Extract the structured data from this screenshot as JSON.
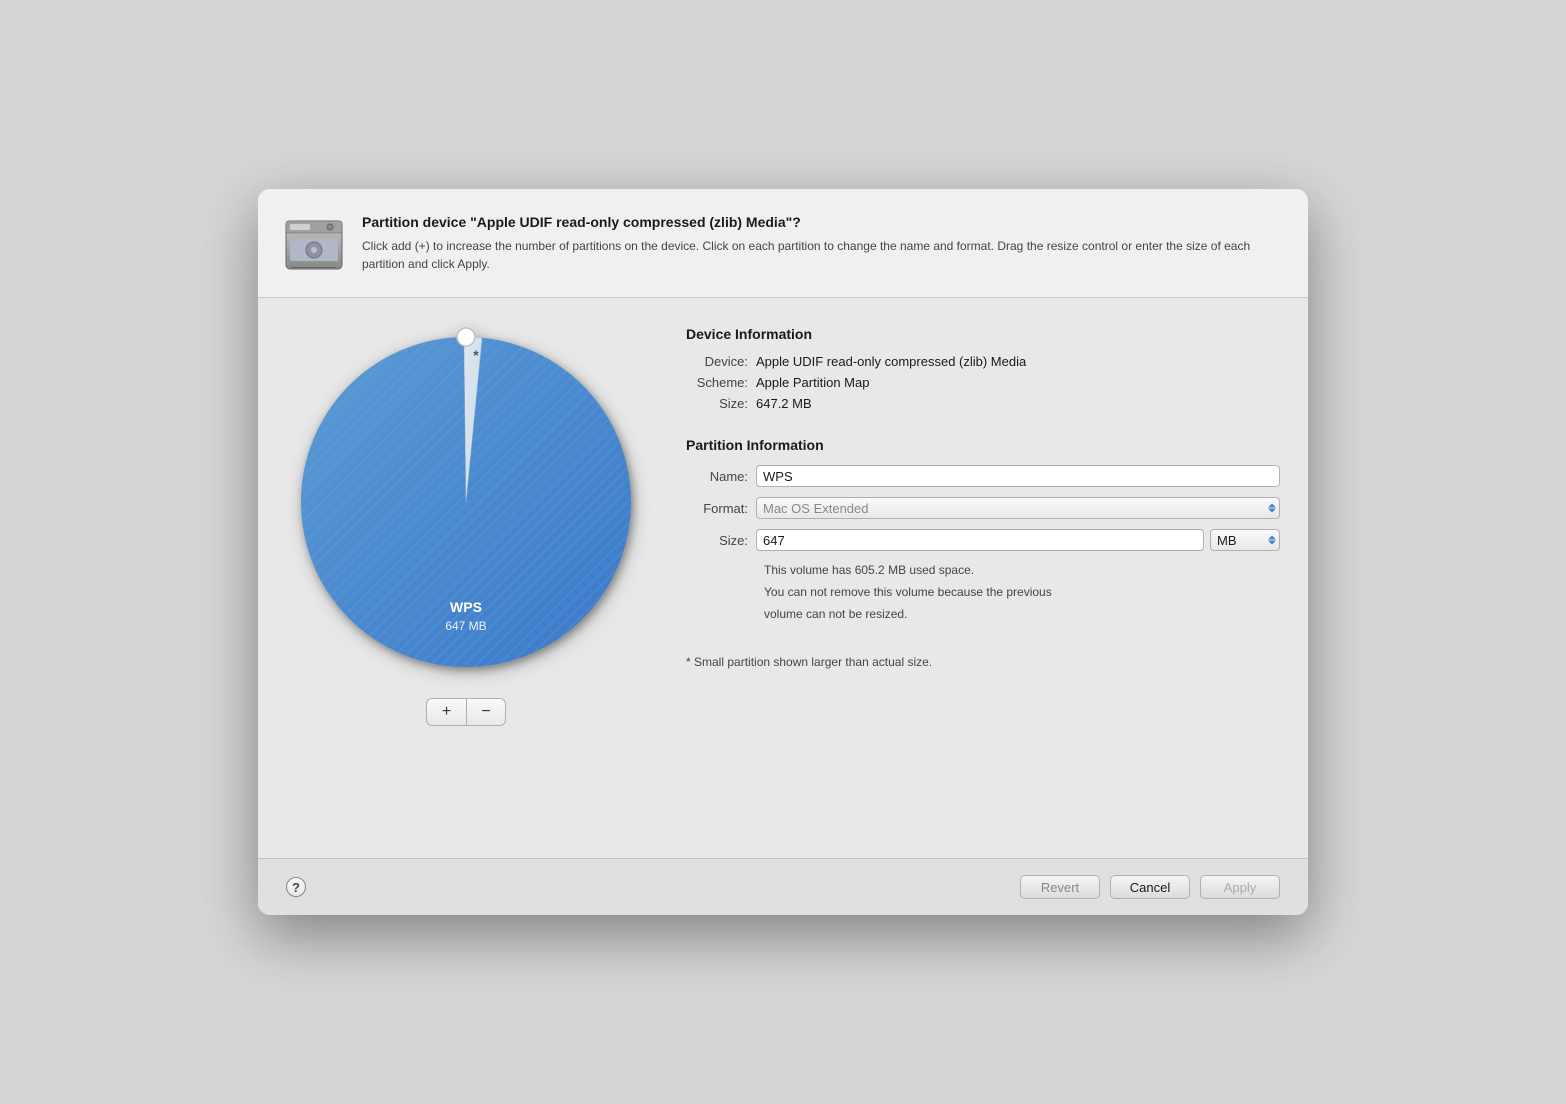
{
  "dialog": {
    "title": "Partition device \"Apple UDIF read-only compressed (zlib) Media\"?",
    "description": "Click add (+) to increase the number of partitions on the device. Click on each partition to change the name and format. Drag the resize control or enter the size of each partition and click Apply."
  },
  "device_info": {
    "section_title": "Device Information",
    "device_label": "Device:",
    "device_value": "Apple UDIF read-only compressed (zlib) Media",
    "scheme_label": "Scheme:",
    "scheme_value": "Apple Partition Map",
    "size_label": "Size:",
    "size_value": "647.2 MB"
  },
  "partition_info": {
    "section_title": "Partition Information",
    "name_label": "Name:",
    "name_value": "WPS",
    "format_label": "Format:",
    "format_placeholder": "Mac OS Extended",
    "size_label": "Size:",
    "size_value": "647",
    "unit_value": "MB",
    "note_line1": "This volume has 605.2 MB used space.",
    "note_line2": "You can not remove this volume because the previous",
    "note_line3": "volume can not be resized.",
    "small_note": "* Small partition shown larger than actual size."
  },
  "chart": {
    "partition_name": "WPS",
    "partition_size": "647 MB"
  },
  "buttons": {
    "add_label": "+",
    "remove_label": "−",
    "revert_label": "Revert",
    "cancel_label": "Cancel",
    "apply_label": "Apply",
    "help_label": "?"
  }
}
